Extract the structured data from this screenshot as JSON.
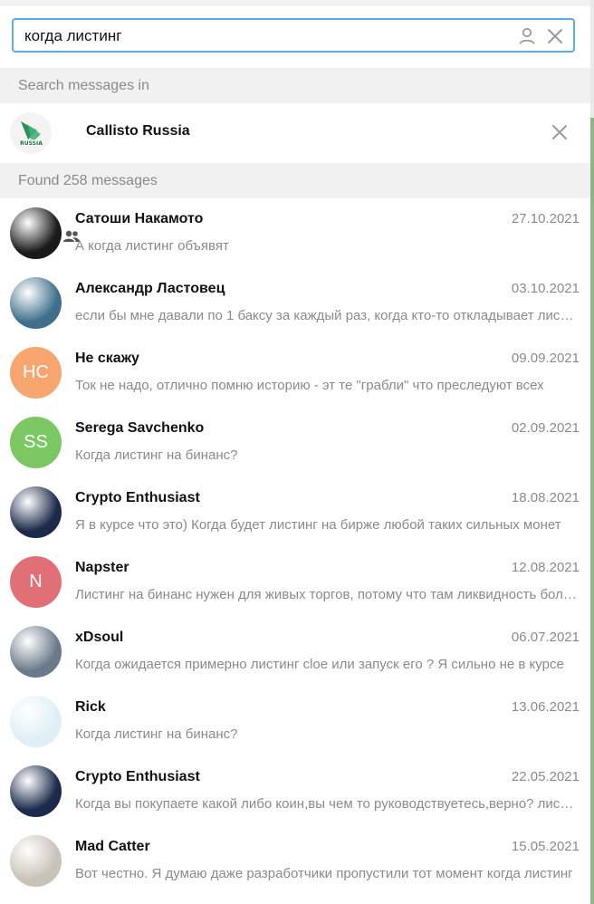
{
  "search": {
    "value": "когда листинг"
  },
  "search_in_header": "Search messages in",
  "filter_chat": {
    "name": "Callisto Russia",
    "avatar_text": "RUSSIA"
  },
  "found_header": "Found 258 messages",
  "colors": {
    "accent": "#5aaee4",
    "header_bg": "#f1f1f1",
    "muted_text": "#8a8a8a"
  },
  "results": [
    {
      "name": "Сатоши Накамото",
      "date": "27.10.2021",
      "preview": "А когда листинг объявят",
      "avatar": {
        "type": "photo",
        "initials": "",
        "color": "#1a1a1a"
      }
    },
    {
      "name": "Александр Ластовец",
      "date": "03.10.2021",
      "preview": "если бы мне давали по 1 баксу за каждый раз, когда кто-то откладывает листинг",
      "avatar": {
        "type": "photo",
        "initials": "",
        "color": "#3f6f8c"
      }
    },
    {
      "name": "Не скажу",
      "date": "09.09.2021",
      "preview": "Ток не надо, отлично помню историю - эт те \"грабли\" что преследуют всех",
      "avatar": {
        "type": "initials",
        "initials": "НС",
        "color": "#f7a66f"
      }
    },
    {
      "name": "Serega Savchenko",
      "date": "02.09.2021",
      "preview": "Когда листинг на бинанс?",
      "avatar": {
        "type": "initials",
        "initials": "SS",
        "color": "#7bc862"
      }
    },
    {
      "name": "Crypto Enthusiast",
      "date": "18.08.2021",
      "preview": "Я в курсе что это) Когда будет листинг на бирже любой таких сильных монет",
      "avatar": {
        "type": "photo",
        "initials": "",
        "color": "#1b2a4a"
      }
    },
    {
      "name": "Napster",
      "date": "12.08.2021",
      "preview": "Листинг на бинанс нужен для живых торгов, потому что там ликвидность больше",
      "avatar": {
        "type": "initials",
        "initials": "N",
        "color": "#e17076"
      }
    },
    {
      "name": "xDsoul",
      "date": "06.07.2021",
      "preview": "Когда ожидается примерно листинг cloe или запуск его ? Я сильно не в курсе",
      "avatar": {
        "type": "photo",
        "initials": "",
        "color": "#6b7a8a"
      }
    },
    {
      "name": "Rick",
      "date": "13.06.2021",
      "preview": "Когда листинг на бинанс?",
      "avatar": {
        "type": "photo",
        "initials": "",
        "color": "#dfeff5"
      }
    },
    {
      "name": "Crypto Enthusiast",
      "date": "22.05.2021",
      "preview": "Когда вы покупаете какой либо коин,вы чем то руководствуетесь,верно? листинг",
      "avatar": {
        "type": "photo",
        "initials": "",
        "color": "#1b2a4a"
      }
    },
    {
      "name": "Mad Catter",
      "date": "15.05.2021",
      "preview": "Вот честно. Я думаю даже разработчики пропустили тот момент когда листинг",
      "avatar": {
        "type": "photo",
        "initials": "",
        "color": "#c9c2b8"
      }
    }
  ]
}
